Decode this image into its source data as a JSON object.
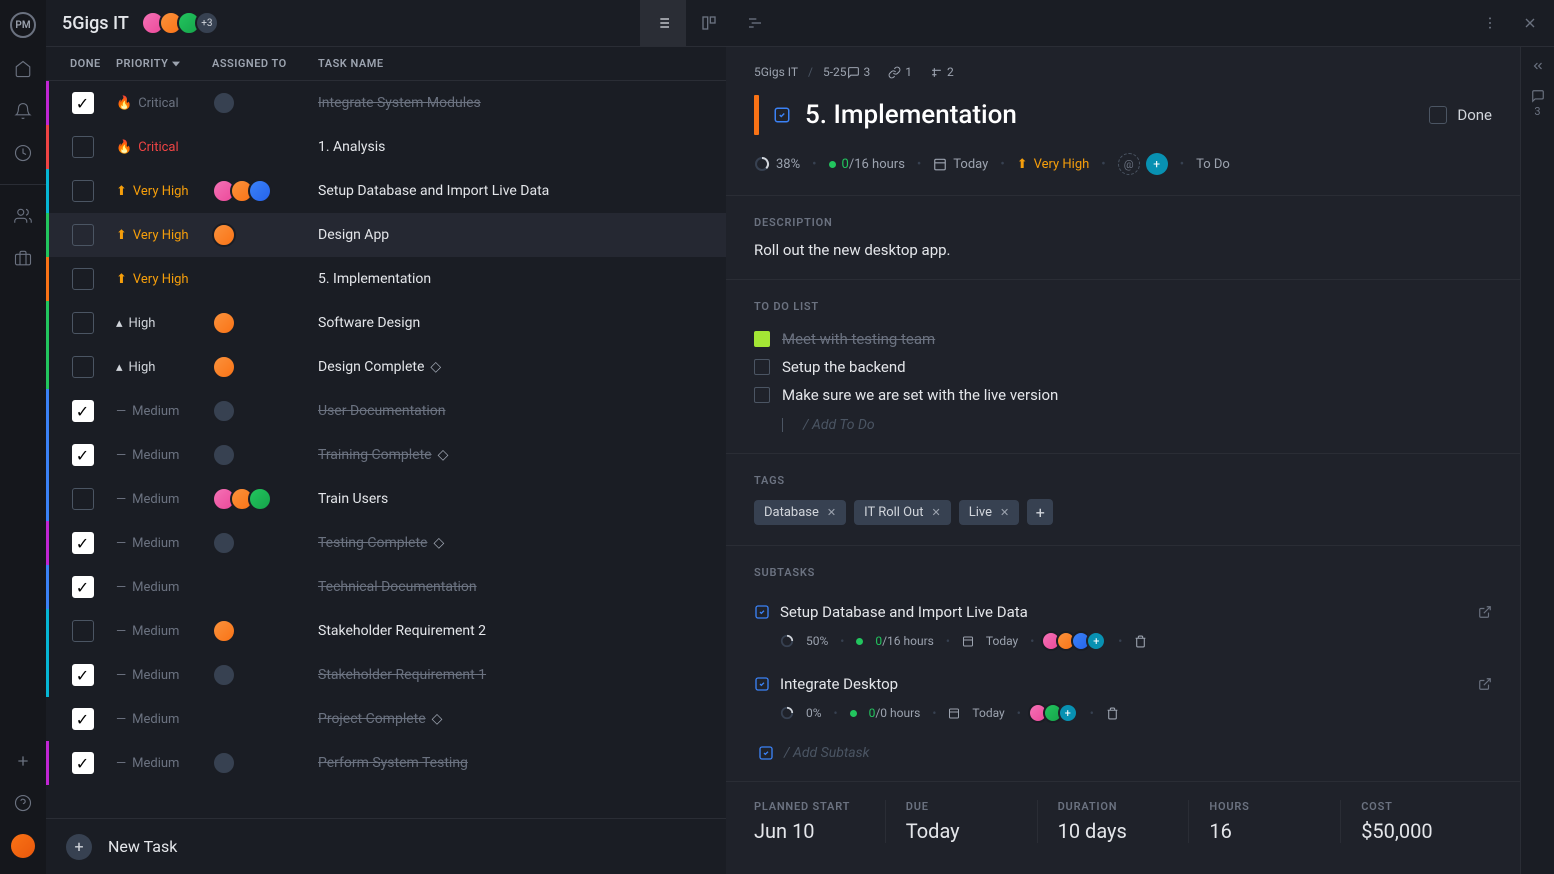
{
  "project_title": "5Gigs IT",
  "avatar_more": "+3",
  "columns": {
    "done": "DONE",
    "priority": "PRIORITY",
    "assigned": "ASSIGNED TO",
    "name": "TASK NAME"
  },
  "new_task": "New Task",
  "tasks": [
    {
      "done": true,
      "prio": "Critical",
      "prio_class": "prio-crit done",
      "icon": "🔥",
      "border": "bc-magenta",
      "name": "Integrate System Modules",
      "strike": true,
      "milestone": false,
      "avatars": [
        "ag"
      ]
    },
    {
      "done": false,
      "prio": "Critical",
      "prio_class": "prio-crit",
      "icon": "🔥",
      "border": "bc-red",
      "name": "1. Analysis",
      "strike": false,
      "milestone": false,
      "avatars": []
    },
    {
      "done": false,
      "prio": "Very High",
      "prio_class": "prio-vh",
      "icon": "⬆",
      "border": "bc-cyan",
      "name": "Setup Database and Import Live Data",
      "strike": false,
      "milestone": false,
      "avatars": [
        "a1",
        "a2",
        "a4"
      ]
    },
    {
      "done": false,
      "prio": "Very High",
      "prio_class": "prio-vh",
      "icon": "⬆",
      "border": "bc-green",
      "name": "Design App",
      "strike": false,
      "milestone": false,
      "avatars": [
        "a2"
      ],
      "selected": true
    },
    {
      "done": false,
      "prio": "Very High",
      "prio_class": "prio-vh",
      "icon": "⬆",
      "border": "bc-orange",
      "name": "5. Implementation",
      "strike": false,
      "milestone": false,
      "avatars": []
    },
    {
      "done": false,
      "prio": "High",
      "prio_class": "prio-high",
      "icon": "▴",
      "border": "bc-green",
      "name": "Software Design",
      "strike": false,
      "milestone": false,
      "avatars": [
        "a2"
      ]
    },
    {
      "done": false,
      "prio": "High",
      "prio_class": "prio-high",
      "icon": "▴",
      "border": "bc-green",
      "name": "Design Complete",
      "strike": false,
      "milestone": true,
      "avatars": [
        "a2"
      ]
    },
    {
      "done": true,
      "prio": "Medium",
      "prio_class": "prio-med",
      "icon": "—",
      "border": "bc-blue",
      "name": "User Documentation",
      "strike": true,
      "milestone": false,
      "avatars": [
        "ag"
      ]
    },
    {
      "done": true,
      "prio": "Medium",
      "prio_class": "prio-med",
      "icon": "—",
      "border": "bc-blue",
      "name": "Training Complete",
      "strike": true,
      "milestone": true,
      "avatars": [
        "ag"
      ]
    },
    {
      "done": false,
      "prio": "Medium",
      "prio_class": "prio-med",
      "icon": "—",
      "border": "bc-blue",
      "name": "Train Users",
      "strike": false,
      "milestone": false,
      "avatars": [
        "a1",
        "a2",
        "a3"
      ]
    },
    {
      "done": true,
      "prio": "Medium",
      "prio_class": "prio-med",
      "icon": "—",
      "border": "bc-magenta",
      "name": "Testing Complete",
      "strike": true,
      "milestone": true,
      "avatars": [
        "ag"
      ]
    },
    {
      "done": true,
      "prio": "Medium",
      "prio_class": "prio-med",
      "icon": "—",
      "border": "bc-blue",
      "name": "Technical Documentation",
      "strike": true,
      "milestone": false,
      "avatars": []
    },
    {
      "done": false,
      "prio": "Medium",
      "prio_class": "prio-med",
      "icon": "—",
      "border": "bc-cyan",
      "name": "Stakeholder Requirement 2",
      "strike": false,
      "milestone": false,
      "avatars": [
        "a2"
      ]
    },
    {
      "done": true,
      "prio": "Medium",
      "prio_class": "prio-med",
      "icon": "—",
      "border": "bc-cyan",
      "name": "Stakeholder Requirement 1",
      "strike": true,
      "milestone": false,
      "avatars": [
        "ag"
      ]
    },
    {
      "done": true,
      "prio": "Medium",
      "prio_class": "prio-med",
      "icon": "—",
      "border": "",
      "name": "Project Complete",
      "strike": true,
      "milestone": true,
      "avatars": []
    },
    {
      "done": true,
      "prio": "Medium",
      "prio_class": "prio-med",
      "icon": "—",
      "border": "bc-magenta",
      "name": "Perform System Testing",
      "strike": true,
      "milestone": false,
      "avatars": [
        "ag"
      ]
    }
  ],
  "detail": {
    "crumb_project": "5Gigs IT",
    "crumb_id": "5-25",
    "counts": {
      "comments": "3",
      "links": "1",
      "subtasks": "2"
    },
    "title": "5. Implementation",
    "done_label": "Done",
    "meta": {
      "progress": "38%",
      "hours": "0/16 hours",
      "date": "Today",
      "priority": "Very High",
      "status": "To Do"
    },
    "desc_label": "DESCRIPTION",
    "description": "Roll out the new desktop app.",
    "todo_label": "TO DO LIST",
    "todos": [
      {
        "done": true,
        "text": "Meet with testing team"
      },
      {
        "done": false,
        "text": "Setup the backend"
      },
      {
        "done": false,
        "text": "Make sure we are set with the live version"
      }
    ],
    "add_todo": "/ Add To Do",
    "tags_label": "TAGS",
    "tags": [
      "Database",
      "IT Roll Out",
      "Live"
    ],
    "subtasks_label": "SUBTASKS",
    "subtasks": [
      {
        "name": "Setup Database and Import Live Data",
        "progress": "50%",
        "hours": "0/16 hours",
        "date": "Today",
        "avatars": [
          "a1",
          "a2",
          "a4"
        ]
      },
      {
        "name": "Integrate Desktop",
        "progress": "0%",
        "hours": "0/0 hours",
        "date": "Today",
        "avatars": [
          "a1",
          "a3"
        ]
      }
    ],
    "add_subtask": "/ Add Subtask",
    "metrics": {
      "start": {
        "label": "PLANNED START",
        "value": "Jun 10"
      },
      "due": {
        "label": "DUE",
        "value": "Today"
      },
      "duration": {
        "label": "DURATION",
        "value": "10 days"
      },
      "hours": {
        "label": "HOURS",
        "value": "16"
      },
      "cost": {
        "label": "COST",
        "value": "$50,000"
      }
    }
  },
  "collapse_count": "3"
}
